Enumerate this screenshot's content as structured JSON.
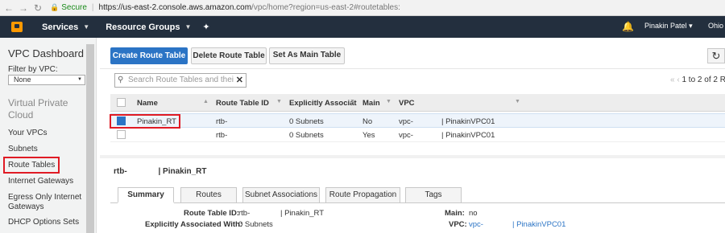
{
  "browser": {
    "back_icon": "arrow-left-icon",
    "forward_icon": "arrow-right-icon",
    "reload_icon": "reload-icon",
    "secure_label": "Secure",
    "url_main": "https://us-east-2.console.aws.amazon.com",
    "url_rest": "/vpc/home?region=us-east-2#routetables:"
  },
  "header": {
    "services": "Services",
    "resource_groups": "Resource Groups",
    "user": "Pinakin Patel",
    "region": "Ohio"
  },
  "sidebar": {
    "title": "VPC Dashboard",
    "filter_label": "Filter by VPC:",
    "filter_value": "None",
    "section": "Virtual Private Cloud",
    "items": [
      {
        "label": "Your VPCs"
      },
      {
        "label": "Subnets"
      },
      {
        "label": "Route Tables"
      },
      {
        "label": "Internet Gateways"
      },
      {
        "label": "Egress Only Internet Gateways"
      },
      {
        "label": "DHCP Options Sets"
      }
    ]
  },
  "toolbar": {
    "create": "Create Route Table",
    "delete": "Delete Route Table",
    "set_main": "Set As Main Table"
  },
  "search": {
    "placeholder": "Search Route Tables and thei"
  },
  "pager": {
    "range": "1 to 2 of 2 R"
  },
  "table": {
    "columns": [
      "Name",
      "Route Table ID",
      "Explicitly Associat",
      "Main",
      "VPC"
    ],
    "rows": [
      {
        "name": "Pinakin_RT",
        "id": "rtb-",
        "assoc": "0 Subnets",
        "main": "No",
        "vpc": "vpc-",
        "vpc_name": "| PinakinVPC01",
        "selected": true
      },
      {
        "name": "",
        "id": "rtb-",
        "assoc": "0 Subnets",
        "main": "Yes",
        "vpc": "vpc-",
        "vpc_name": "| PinakinVPC01",
        "selected": false
      }
    ]
  },
  "details": {
    "title_id": "rtb-",
    "title_name": "| Pinakin_RT",
    "tabs": [
      "Summary",
      "Routes",
      "Subnet Associations",
      "Route Propagation",
      "Tags"
    ],
    "active_tab": "Summary",
    "route_table_id_label": "Route Table ID:",
    "route_table_id_value": "rtb-",
    "route_table_name": "| Pinakin_RT",
    "explicit_label": "Explicitly Associated With:",
    "explicit_value": "0 Subnets",
    "main_label": "Main:",
    "main_value": "no",
    "vpc_label": "VPC:",
    "vpc_value": "vpc-",
    "vpc_name": "| PinakinVPC01"
  },
  "colors": {
    "aws_header": "#232f3e",
    "primary_button": "#2b74c5",
    "highlight_box": "#e01b24"
  }
}
